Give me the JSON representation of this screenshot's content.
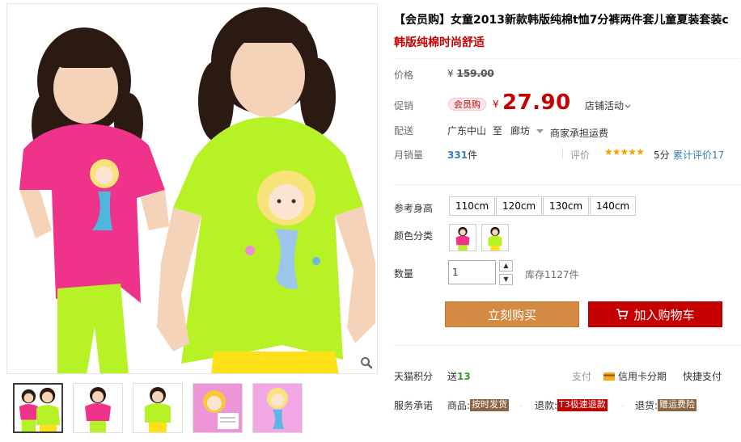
{
  "product": {
    "title": "【会员购】女童2013新款韩版纯棉t恤7分裤两件套儿童夏装套装c",
    "subtitle": "韩版纯棉时尚舒适"
  },
  "price": {
    "label": "价格",
    "currency": "¥",
    "original": "159.00",
    "promo_label": "促销",
    "promo_badge": "会员购",
    "promo_price": "27.90",
    "shop_activity": "店铺活动"
  },
  "shipping": {
    "label": "配送",
    "from": "广东中山",
    "to_word": "至",
    "to": "廊坊",
    "fee": "商家承担运费"
  },
  "sales": {
    "label": "月销量",
    "count": "331",
    "unit": "件",
    "rating_label": "评价",
    "rating_stars": "★★★★★",
    "rating_score": "5分",
    "review_count": "累计评价17"
  },
  "sku": {
    "size_label": "参考身高",
    "sizes": [
      "110cm",
      "120cm",
      "130cm",
      "140cm"
    ],
    "color_label": "颜色分类",
    "colors": [
      "pink",
      "green"
    ],
    "qty_label": "数量",
    "qty_value": "1",
    "stock": "库存1127件"
  },
  "actions": {
    "buy_now": "立刻购买",
    "add_to_cart": "加入购物车"
  },
  "services": {
    "points_label": "天猫积分",
    "points_prefix": "送",
    "points_value": "13",
    "pay_label": "支付",
    "pay_credit": "信用卡分期",
    "pay_quick": "快捷支付",
    "promise_label": "服务承诺",
    "goods_label": "商品:",
    "goods_tag": "按时发货",
    "refund_label": "退款:",
    "refund_tag": "T3极速退款",
    "return_label": "退货:",
    "return_tag": "赠运费险"
  },
  "colors": {
    "accent_red": "#c40000",
    "buy_brown": "#d38a42",
    "pink_shirt": "#f0338a",
    "green_shirt": "#b7f227",
    "yellow_pants": "#ffe11a"
  },
  "icons": [
    "zoom-icon",
    "cart-icon",
    "credit-card-icon",
    "chevron-down-icon"
  ]
}
